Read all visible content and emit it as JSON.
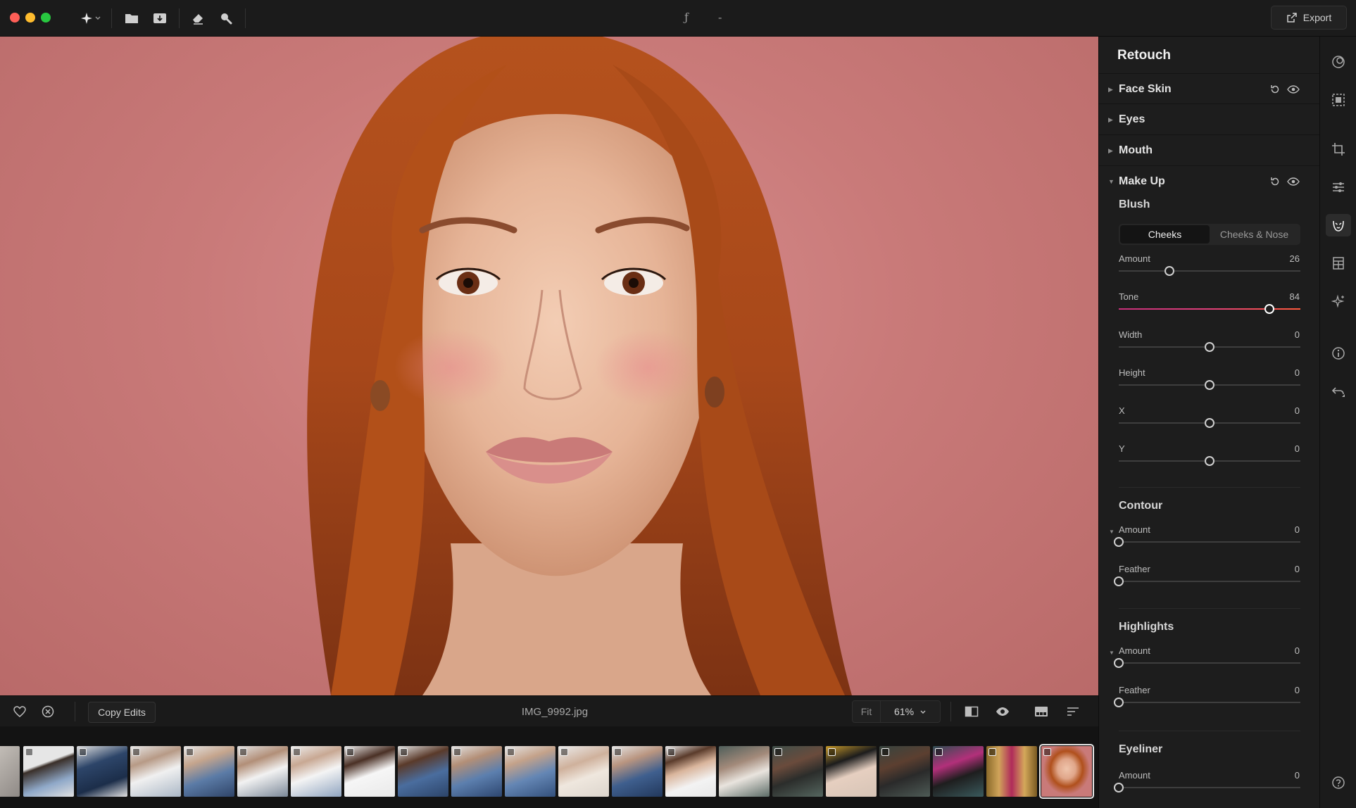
{
  "toolbar": {
    "center_glyph_1": "ƒ",
    "center_glyph_2": "-",
    "export_label": "Export"
  },
  "bottom": {
    "copy_edits_label": "Copy Edits",
    "filename": "IMG_9992.jpg",
    "fit_label": "Fit",
    "zoom_level": "61%"
  },
  "filmstrip": {
    "thumb_count": 21,
    "selected_index": 20
  },
  "panel": {
    "title": "Retouch",
    "sections": {
      "face_skin": "Face Skin",
      "eyes": "Eyes",
      "mouth": "Mouth",
      "make_up": "Make Up"
    },
    "blush": {
      "title": "Blush",
      "tabs": [
        "Cheeks",
        "Cheeks & Nose"
      ],
      "active_tab": 0,
      "sliders": [
        {
          "label": "Amount",
          "value": "26",
          "fraction": 0.28
        },
        {
          "label": "Tone",
          "value": "84",
          "fraction": 0.83
        },
        {
          "label": "Width",
          "value": "0",
          "fraction": 0.5
        },
        {
          "label": "Height",
          "value": "0",
          "fraction": 0.5
        },
        {
          "label": "X",
          "value": "0",
          "fraction": 0.5
        },
        {
          "label": "Y",
          "value": "0",
          "fraction": 0.5
        }
      ]
    },
    "contour": {
      "title": "Contour",
      "sliders": [
        {
          "label": "Amount",
          "value": "0",
          "fraction": 0
        },
        {
          "label": "Feather",
          "value": "0",
          "fraction": 0
        }
      ]
    },
    "highlights": {
      "title": "Highlights",
      "sliders": [
        {
          "label": "Amount",
          "value": "0",
          "fraction": 0
        },
        {
          "label": "Feather",
          "value": "0",
          "fraction": 0
        }
      ]
    },
    "eyeliner": {
      "title": "Eyeliner",
      "sliders": [
        {
          "label": "Amount",
          "value": "0",
          "fraction": 0
        }
      ]
    }
  }
}
